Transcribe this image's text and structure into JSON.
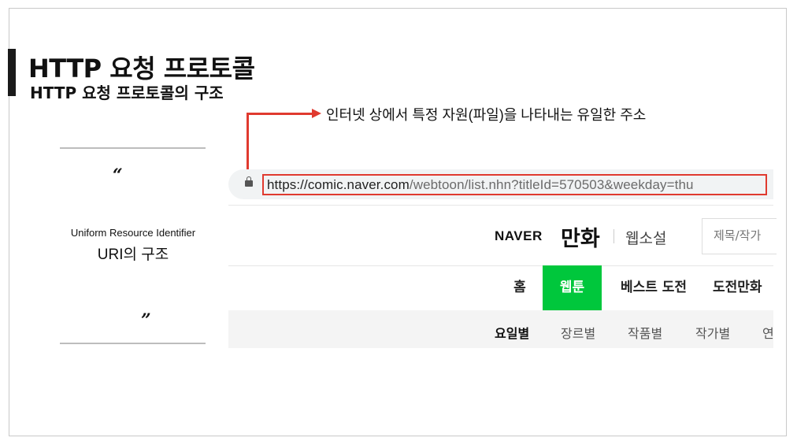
{
  "slide": {
    "title": "HTTP 요청 프로토콜",
    "subtitle": "HTTP 요청 프로토콜의 구조"
  },
  "quote_panel": {
    "open_quote": "“",
    "close_quote": "”",
    "uri_full": "Uniform Resource Identifier",
    "uri_title": "URI의 구조"
  },
  "annotation": {
    "text": "인터넷 상에서 특정 자원(파일)을 나타내는 유일한 주소"
  },
  "browser": {
    "url_main": "https://comic.naver.com",
    "url_rest": "/webtoon/list.nhn?titleId=570503&weekday=thu",
    "icons": {
      "lock": "lock-icon"
    }
  },
  "site": {
    "logo": "NAVER",
    "service": "만화",
    "sub_service": "웹소설",
    "search_placeholder": "제목/작가"
  },
  "nav": {
    "items": [
      "홈",
      "웹툰",
      "베스트 도전",
      "도전만화"
    ],
    "active": "웹툰",
    "active_color": "#00c73c"
  },
  "subnav": {
    "items": [
      "요일별",
      "장르별",
      "작품별",
      "작가별",
      "연"
    ],
    "active": "요일별"
  },
  "colors": {
    "annotation_red": "#e03a2f"
  }
}
